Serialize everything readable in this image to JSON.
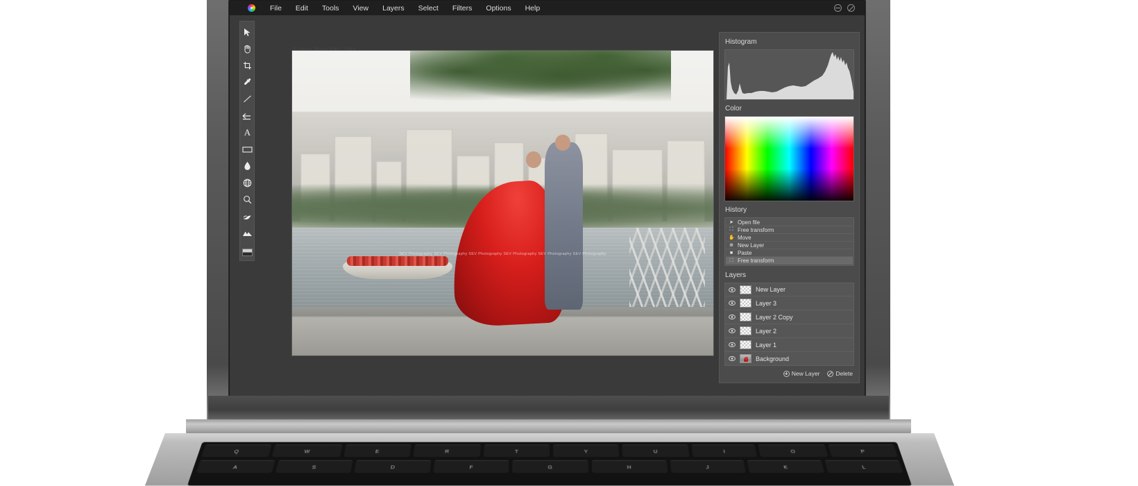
{
  "app": {
    "logo_icon": "color-wheel-icon",
    "menu": [
      "File",
      "Edit",
      "Tools",
      "View",
      "Layers",
      "Select",
      "Filters",
      "Options",
      "Help"
    ],
    "window_controls": [
      {
        "name": "minimize-button",
        "icon": "minus-circle-icon"
      },
      {
        "name": "close-button",
        "icon": "slash-circle-icon"
      }
    ]
  },
  "toolbar": {
    "tools": [
      {
        "name": "move-tool",
        "icon": "cursor-arrow-icon"
      },
      {
        "name": "hand-tool",
        "icon": "hand-icon"
      },
      {
        "name": "crop-tool",
        "icon": "crop-icon"
      },
      {
        "name": "eyedropper-tool",
        "icon": "eyedropper-icon"
      },
      {
        "name": "line-tool",
        "icon": "line-icon"
      },
      {
        "name": "undo-tool",
        "icon": "undo-arrow-icon"
      },
      {
        "name": "text-tool",
        "icon": "text-a-icon"
      },
      {
        "name": "rectangle-tool",
        "icon": "rectangle-icon"
      },
      {
        "name": "blur-tool",
        "icon": "droplet-icon"
      },
      {
        "name": "web-tool",
        "icon": "globe-icon"
      },
      {
        "name": "zoom-tool",
        "icon": "magnifier-icon"
      },
      {
        "name": "brush-tool",
        "icon": "brush-leaf-icon"
      },
      {
        "name": "landscape-tool",
        "icon": "mountains-icon"
      },
      {
        "name": "color-swatch",
        "icon": "foreground-background-swatch-icon"
      }
    ]
  },
  "canvas": {
    "document_title": "Father Blog IMG_003",
    "watermark": "SEV Photography  SEV Photography  SEV Photography  SEV Photography  SEV Photography  SEV Photography"
  },
  "panels": {
    "histogram": {
      "title": "Histogram"
    },
    "color": {
      "title": "Color"
    },
    "history": {
      "title": "History",
      "items": [
        {
          "label": "Open file",
          "icon": "cursor-icon",
          "selected": false
        },
        {
          "label": "Free transform",
          "icon": "transform-icon",
          "selected": false
        },
        {
          "label": "Move",
          "icon": "hand-icon",
          "selected": false
        },
        {
          "label": "New Layer",
          "icon": "plus-circle-icon",
          "selected": false
        },
        {
          "label": "Paste",
          "icon": "paste-icon",
          "selected": false
        },
        {
          "label": "Free transform",
          "icon": "transform-icon",
          "selected": true
        }
      ]
    },
    "layers": {
      "title": "Layers",
      "items": [
        {
          "label": "New Layer",
          "visible": true,
          "thumb": "checker"
        },
        {
          "label": "Layer 3",
          "visible": true,
          "thumb": "checker"
        },
        {
          "label": "Layer 2 Copy",
          "visible": true,
          "thumb": "checker"
        },
        {
          "label": "Layer 2",
          "visible": true,
          "thumb": "checker"
        },
        {
          "label": "Layer 1",
          "visible": true,
          "thumb": "checker"
        },
        {
          "label": "Background",
          "visible": true,
          "thumb": "photo"
        }
      ],
      "actions": [
        {
          "label": "New Layer",
          "icon": "plus-circle-icon"
        },
        {
          "label": "Delete",
          "icon": "slash-circle-icon"
        }
      ]
    }
  },
  "keyboard": {
    "row1": [
      "Q",
      "W",
      "E",
      "R",
      "T",
      "Y",
      "U",
      "I",
      "O",
      "P"
    ],
    "row2": [
      "A",
      "S",
      "D",
      "F",
      "G",
      "H",
      "J",
      "K",
      "L"
    ]
  },
  "colors": {
    "menubar_bg": "#1f1f1f",
    "app_bg": "#3a3a3a",
    "panel_bg": "#4b4b4b",
    "row_bg": "#565656",
    "text": "#dcdcdc",
    "selected_row": "#6a6a6a"
  }
}
